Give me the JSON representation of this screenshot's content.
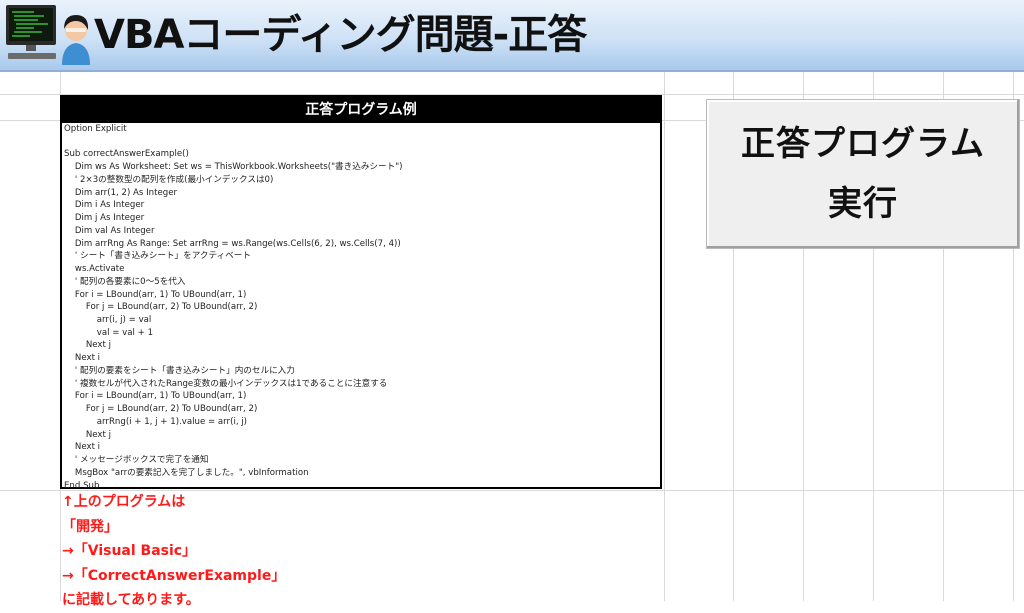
{
  "header": {
    "title": "VBAコーディング問題-正答",
    "avatar_icon": "programmer-at-computer-icon"
  },
  "code_panel": {
    "title": "正答プログラム例",
    "lines": [
      "Option Explicit",
      "",
      "Sub correctAnswerExample()",
      "    Dim ws As Worksheet: Set ws = ThisWorkbook.Worksheets(\"書き込みシート\")",
      "    ' 2×3の整数型の配列を作成(最小インデックスは0)",
      "    Dim arr(1, 2) As Integer",
      "    Dim i As Integer",
      "    Dim j As Integer",
      "    Dim val As Integer",
      "    Dim arrRng As Range: Set arrRng = ws.Range(ws.Cells(6, 2), ws.Cells(7, 4))",
      "    ' シート「書き込みシート」をアクティベート",
      "    ws.Activate",
      "    ' 配列の各要素に0～5を代入",
      "    For i = LBound(arr, 1) To UBound(arr, 1)",
      "        For j = LBound(arr, 2) To UBound(arr, 2)",
      "            arr(i, j) = val",
      "            val = val + 1",
      "        Next j",
      "    Next i",
      "    ' 配列の要素をシート「書き込みシート」内のセルに入力",
      "    ' 複数セルが代入されたRange変数の最小インデックスは1であることに注意する",
      "    For i = LBound(arr, 1) To UBound(arr, 1)",
      "        For j = LBound(arr, 2) To UBound(arr, 2)",
      "            arrRng(i + 1, j + 1).value = arr(i, j)",
      "        Next j",
      "    Next i",
      "    ' メッセージボックスで完了を通知",
      "    MsgBox \"arrの要素記入を完了しました。\", vbInformation",
      "End Sub"
    ]
  },
  "run_button": {
    "line1": "正答プログラム",
    "line2": "実行"
  },
  "notes": [
    "↑上のプログラムは",
    "「開発」",
    "→「Visual Basic」",
    "→「CorrectAnswerExample」",
    "に記載してあります。"
  ],
  "colors": {
    "note_text": "#ff1a1a",
    "panel_header_bg": "#000000",
    "header_gradient_bottom": "#a9c9ec"
  }
}
